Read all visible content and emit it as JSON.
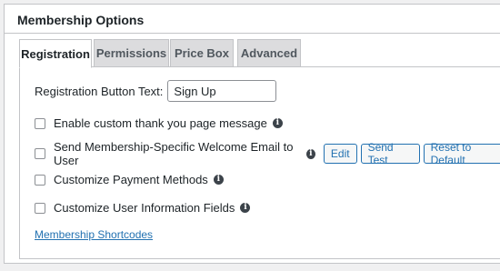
{
  "panel": {
    "title": "Membership Options"
  },
  "tabs": [
    {
      "label": "Registration",
      "active": true
    },
    {
      "label": "Permissions",
      "active": false
    },
    {
      "label": "Price Box",
      "active": false
    },
    {
      "label": "Advanced",
      "active": false
    }
  ],
  "registration": {
    "button_text_label": "Registration Button Text:",
    "button_text_value": "Sign Up",
    "options": [
      {
        "label": "Enable custom thank you page message",
        "checked": false,
        "info_icon": "info-icon"
      },
      {
        "label": "Send Membership-Specific Welcome Email to User",
        "checked": false,
        "info_icon": "info-icon"
      },
      {
        "label": "Customize Payment Methods",
        "checked": false,
        "info_icon": "info-icon"
      },
      {
        "label": "Customize User Information Fields",
        "checked": false,
        "info_icon": "info-icon"
      }
    ],
    "email_buttons": {
      "edit": "Edit",
      "send_test": "Send Test",
      "reset": "Reset to Default"
    },
    "shortcodes_link": "Membership Shortcodes"
  },
  "colors": {
    "accent": "#2271b1",
    "border": "#c3c4c7",
    "inactive_tab": "#dcdcde"
  }
}
